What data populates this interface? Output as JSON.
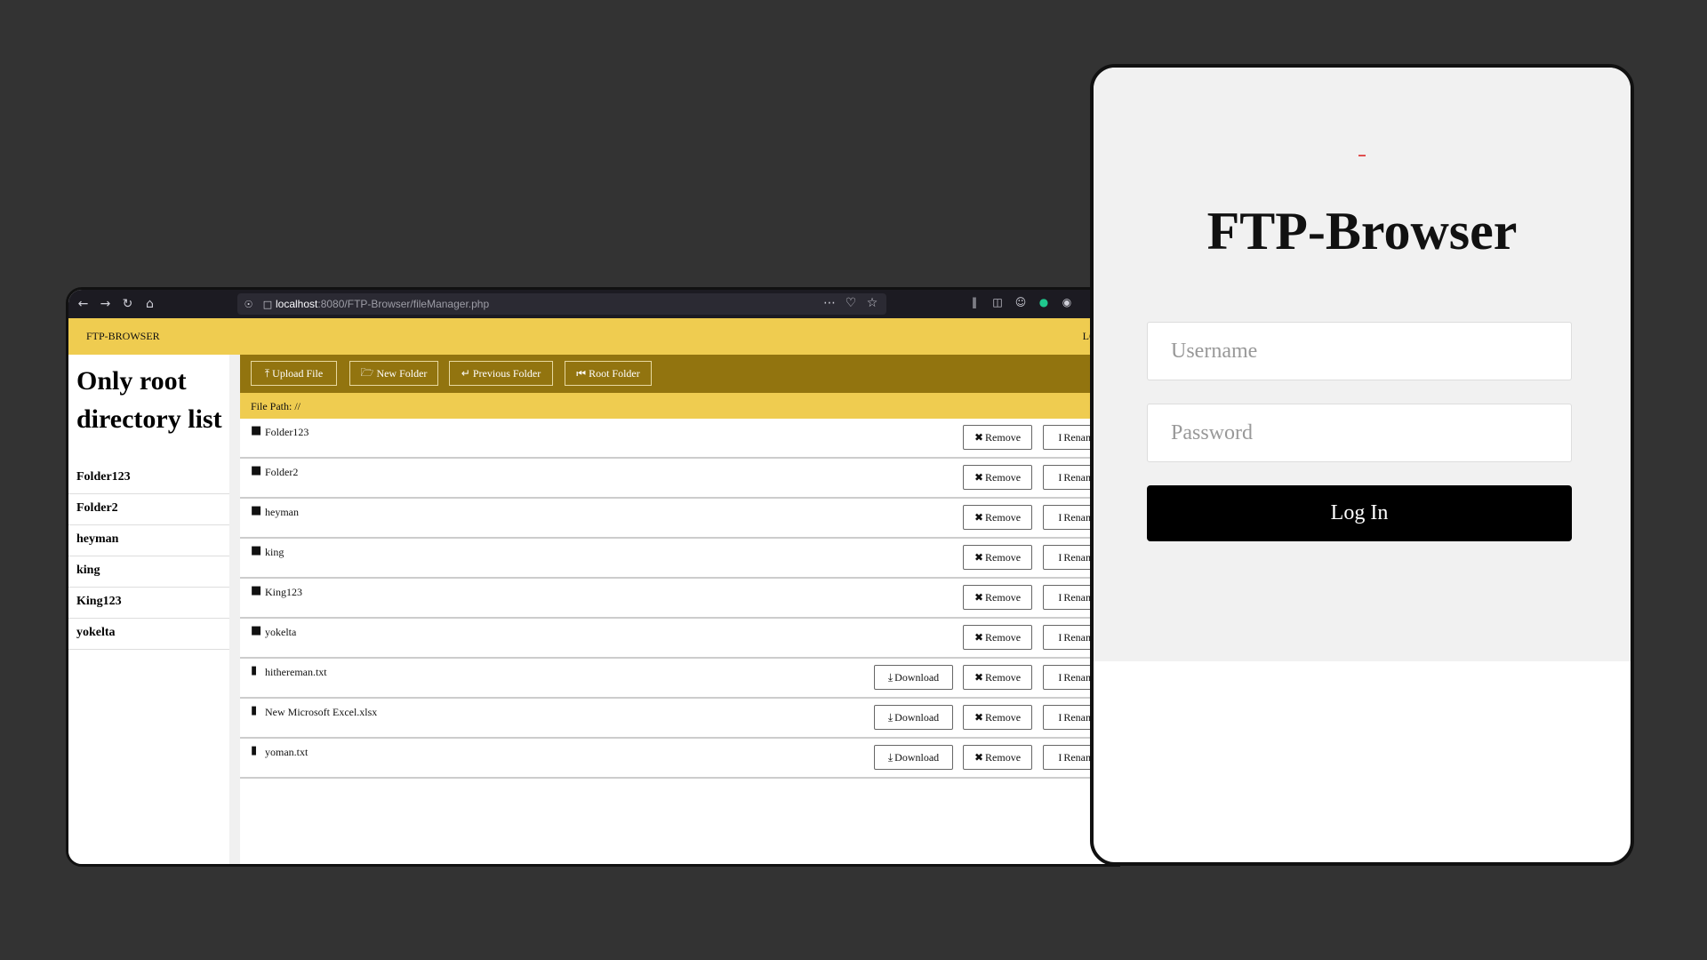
{
  "browser": {
    "url_host": "localhost",
    "url_path": ":8080/FTP-Browser/fileManager.php"
  },
  "header": {
    "brand": "FTP-BROWSER",
    "logout": "LOGOUT"
  },
  "sidebar": {
    "title": "Only root directory list",
    "items": [
      "Folder123",
      "Folder2",
      "heyman",
      "king",
      "King123",
      "yokelta"
    ]
  },
  "actions": {
    "upload": "Upload File",
    "new_folder": "New Folder",
    "previous": "Previous Folder",
    "root": "Root Folder"
  },
  "file_path": "File Path: //",
  "buttons": {
    "download": "Download",
    "remove": "Remove",
    "rename": "Rename"
  },
  "files": [
    {
      "name": "Folder123",
      "type": "folder"
    },
    {
      "name": "Folder2",
      "type": "folder"
    },
    {
      "name": "heyman",
      "type": "folder"
    },
    {
      "name": "king",
      "type": "folder"
    },
    {
      "name": "King123",
      "type": "folder"
    },
    {
      "name": "yokelta",
      "type": "folder"
    },
    {
      "name": "hithereman.txt",
      "type": "file"
    },
    {
      "name": "New Microsoft Excel.xlsx",
      "type": "file"
    },
    {
      "name": "yoman.txt",
      "type": "file"
    }
  ],
  "login": {
    "title": "FTP-Browser",
    "username_placeholder": "Username",
    "password_placeholder": "Password",
    "submit": "Log In"
  }
}
